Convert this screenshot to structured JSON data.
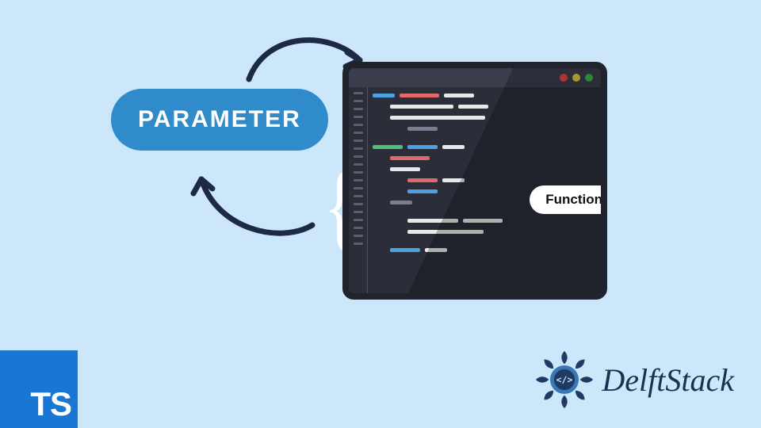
{
  "diagram": {
    "parameter_label": "PARAMETER",
    "function_label": "Function",
    "brace_glyph": "{",
    "arrows": [
      "top-curve",
      "bottom-curve"
    ]
  },
  "code_window": {
    "traffic_lights": [
      "red",
      "yellow",
      "green"
    ],
    "line_count": 20
  },
  "logos": {
    "ts": "TS",
    "brand": "DelftStack",
    "brand_glyph": "</>"
  },
  "colors": {
    "background": "#cde7fa",
    "pill": "#2f8bc9",
    "arrow": "#1c2a46",
    "window_body": "#2b2e39",
    "window_frame": "#21232c",
    "ts_bg": "#1976d2",
    "brand_text": "#19324f"
  }
}
